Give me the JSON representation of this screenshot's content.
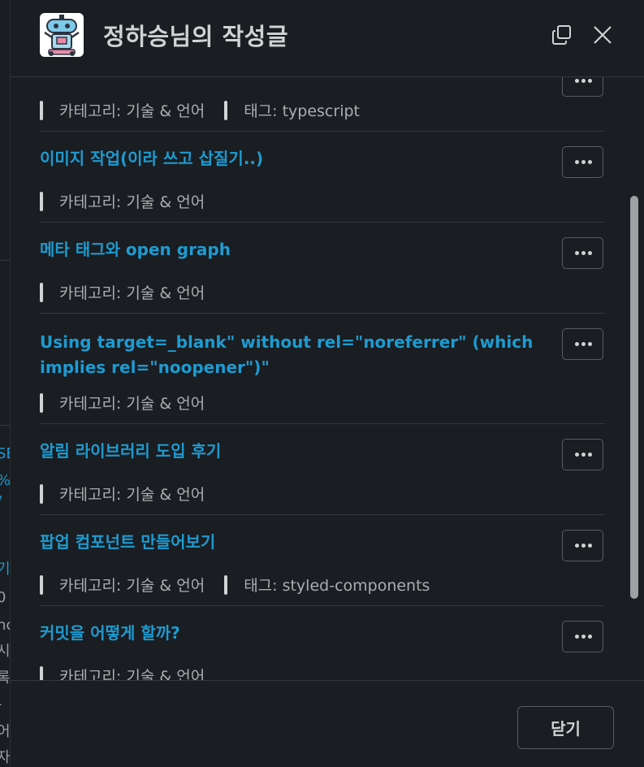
{
  "background": {
    "fragments": [
      "SE",
      "%",
      "/",
      "기",
      "0",
      "nc",
      "시",
      "록",
      "-",
      "어",
      "자"
    ]
  },
  "modal": {
    "title": "정하승님의 작성글",
    "avatar_icon": "robot-icon",
    "copy_icon": "copy-icon",
    "close_icon": "close-icon"
  },
  "posts": [
    {
      "title": "",
      "category": "카테고리: 기술 & 언어",
      "tag": "태그: typescript"
    },
    {
      "title": "이미지 작업(이라 쓰고 삽질기..)",
      "category": "카테고리: 기술 & 언어",
      "tag": ""
    },
    {
      "title": "메타 태그와 open graph",
      "category": "카테고리: 기술 & 언어",
      "tag": ""
    },
    {
      "title": "Using target=_blank\" without rel=\"noreferrer\" (which implies rel=\"noopener\")\"",
      "category": "카테고리: 기술 & 언어",
      "tag": ""
    },
    {
      "title": "알림 라이브러리 도입 후기",
      "category": "카테고리: 기술 & 언어",
      "tag": ""
    },
    {
      "title": "팝업 컴포넌트 만들어보기",
      "category": "카테고리: 기술 & 언어",
      "tag": "태그: styled-components"
    },
    {
      "title": "커밋을 어떻게 할까?",
      "category": "카테고리: 기술 & 언어",
      "tag": ""
    }
  ],
  "more_icon": "more-horizontal-icon",
  "footer": {
    "close_label": "닫기"
  },
  "colors": {
    "background": "#1a1d21",
    "link": "#1d9bd1",
    "text": "#d1d2d3",
    "muted": "#abadb1",
    "divider": "#35373b"
  }
}
